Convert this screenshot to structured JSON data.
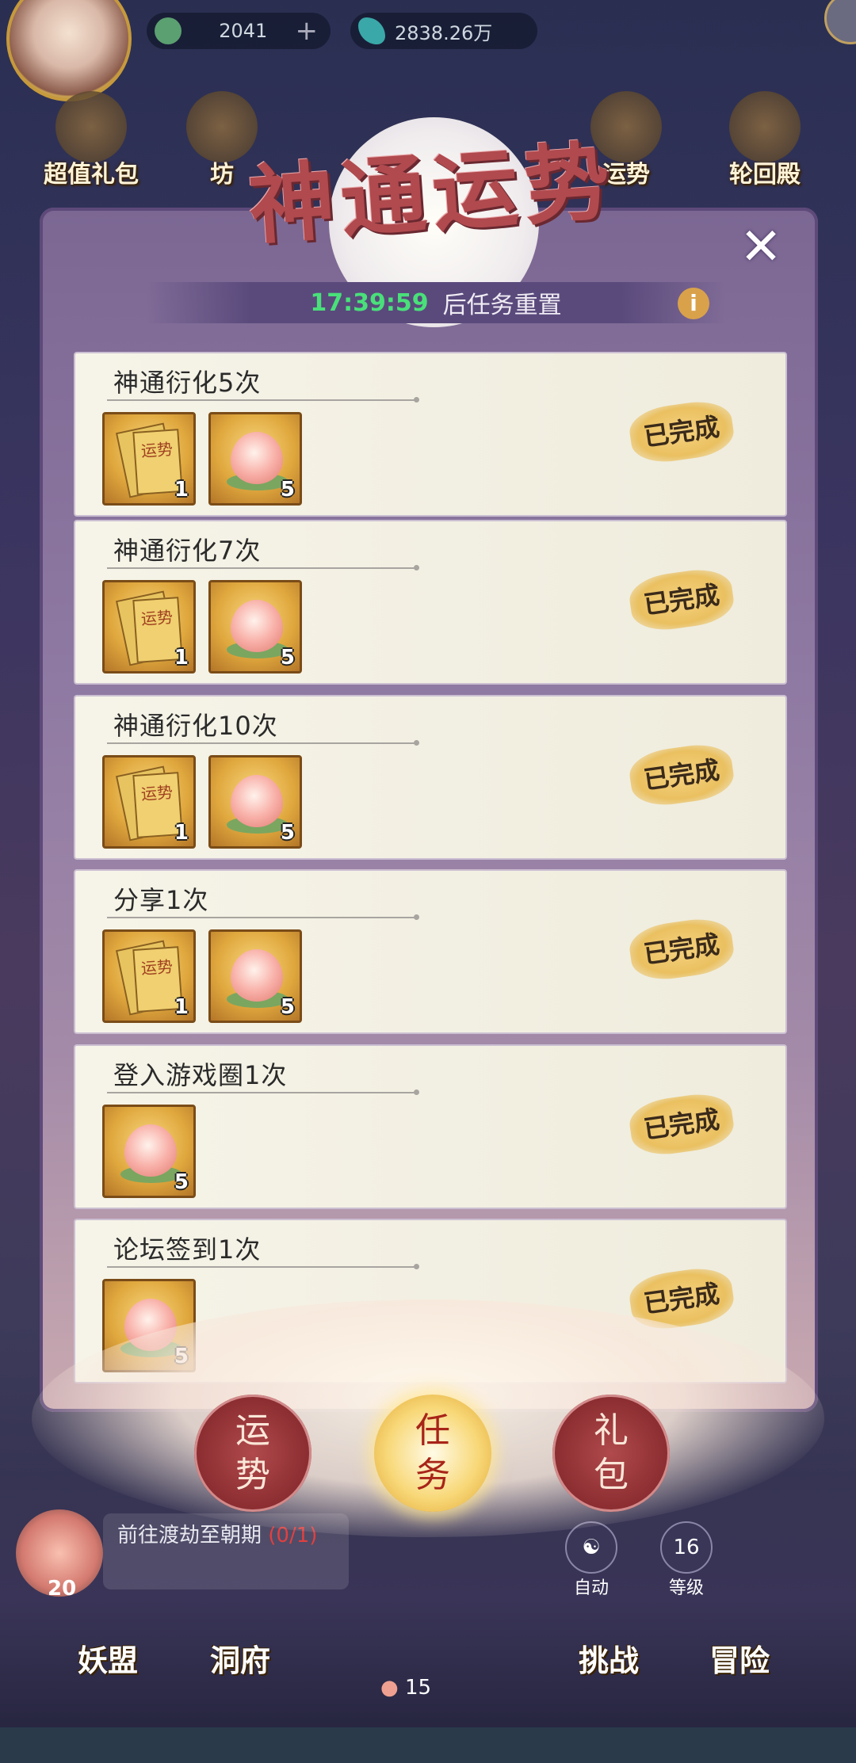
{
  "top_bar": {
    "currency1": "2041",
    "currency1_add": "+",
    "currency2": "2838.26万"
  },
  "top_icons": [
    {
      "label": "超值礼包",
      "icon": "gift-bag-icon"
    },
    {
      "label": "坊",
      "icon": "coin-icon"
    },
    {
      "label": "运势",
      "icon": "fortune-icon"
    },
    {
      "label": "轮回殿",
      "icon": "temple-icon"
    }
  ],
  "panel": {
    "title": "神通运势",
    "close_label": "✕",
    "timer": "17:39:59",
    "timer_suffix": "后任务重置",
    "info_label": "i",
    "tasks": [
      {
        "name": "神通衍化5次",
        "rewards": [
          {
            "type": "ticket",
            "ticket_text": "运势",
            "count": "1"
          },
          {
            "type": "peach",
            "count": "5"
          }
        ],
        "status": "已完成"
      },
      {
        "name": "神通衍化7次",
        "rewards": [
          {
            "type": "ticket",
            "ticket_text": "运势",
            "count": "1"
          },
          {
            "type": "peach",
            "count": "5"
          }
        ],
        "status": "已完成"
      },
      {
        "name": "神通衍化10次",
        "rewards": [
          {
            "type": "ticket",
            "ticket_text": "运势",
            "count": "1"
          },
          {
            "type": "peach",
            "count": "5"
          }
        ],
        "status": "已完成"
      },
      {
        "name": "分享1次",
        "rewards": [
          {
            "type": "ticket",
            "ticket_text": "运势",
            "count": "1"
          },
          {
            "type": "peach",
            "count": "5"
          }
        ],
        "status": "已完成"
      },
      {
        "name": "登入游戏圈1次",
        "rewards": [
          {
            "type": "peach",
            "count": "5"
          }
        ],
        "status": "已完成"
      },
      {
        "name": "论坛签到1次",
        "rewards": [
          {
            "type": "peach",
            "count": "5"
          }
        ],
        "status": "已完成"
      }
    ]
  },
  "tabs": [
    {
      "line1": "运",
      "line2": "势",
      "active": false
    },
    {
      "line1": "任",
      "line2": "务",
      "active": true
    },
    {
      "line1": "礼",
      "line2": "包",
      "active": false
    }
  ],
  "hud": {
    "quest_text": "前往渡劫至朝期",
    "quest_progress": "(0/1)",
    "peach_count": "20",
    "auto_label": "自动",
    "level_value": "16",
    "level_label": "等级",
    "center_count": "15",
    "nav": [
      "妖盟",
      "洞府",
      "挑战",
      "冒险"
    ]
  },
  "colors": {
    "timer": "#49e07a",
    "title": "#b04a4e",
    "done_badge": "#eac060",
    "active_tab": "#f8d878",
    "inactive_tab": "#8a2c30"
  }
}
